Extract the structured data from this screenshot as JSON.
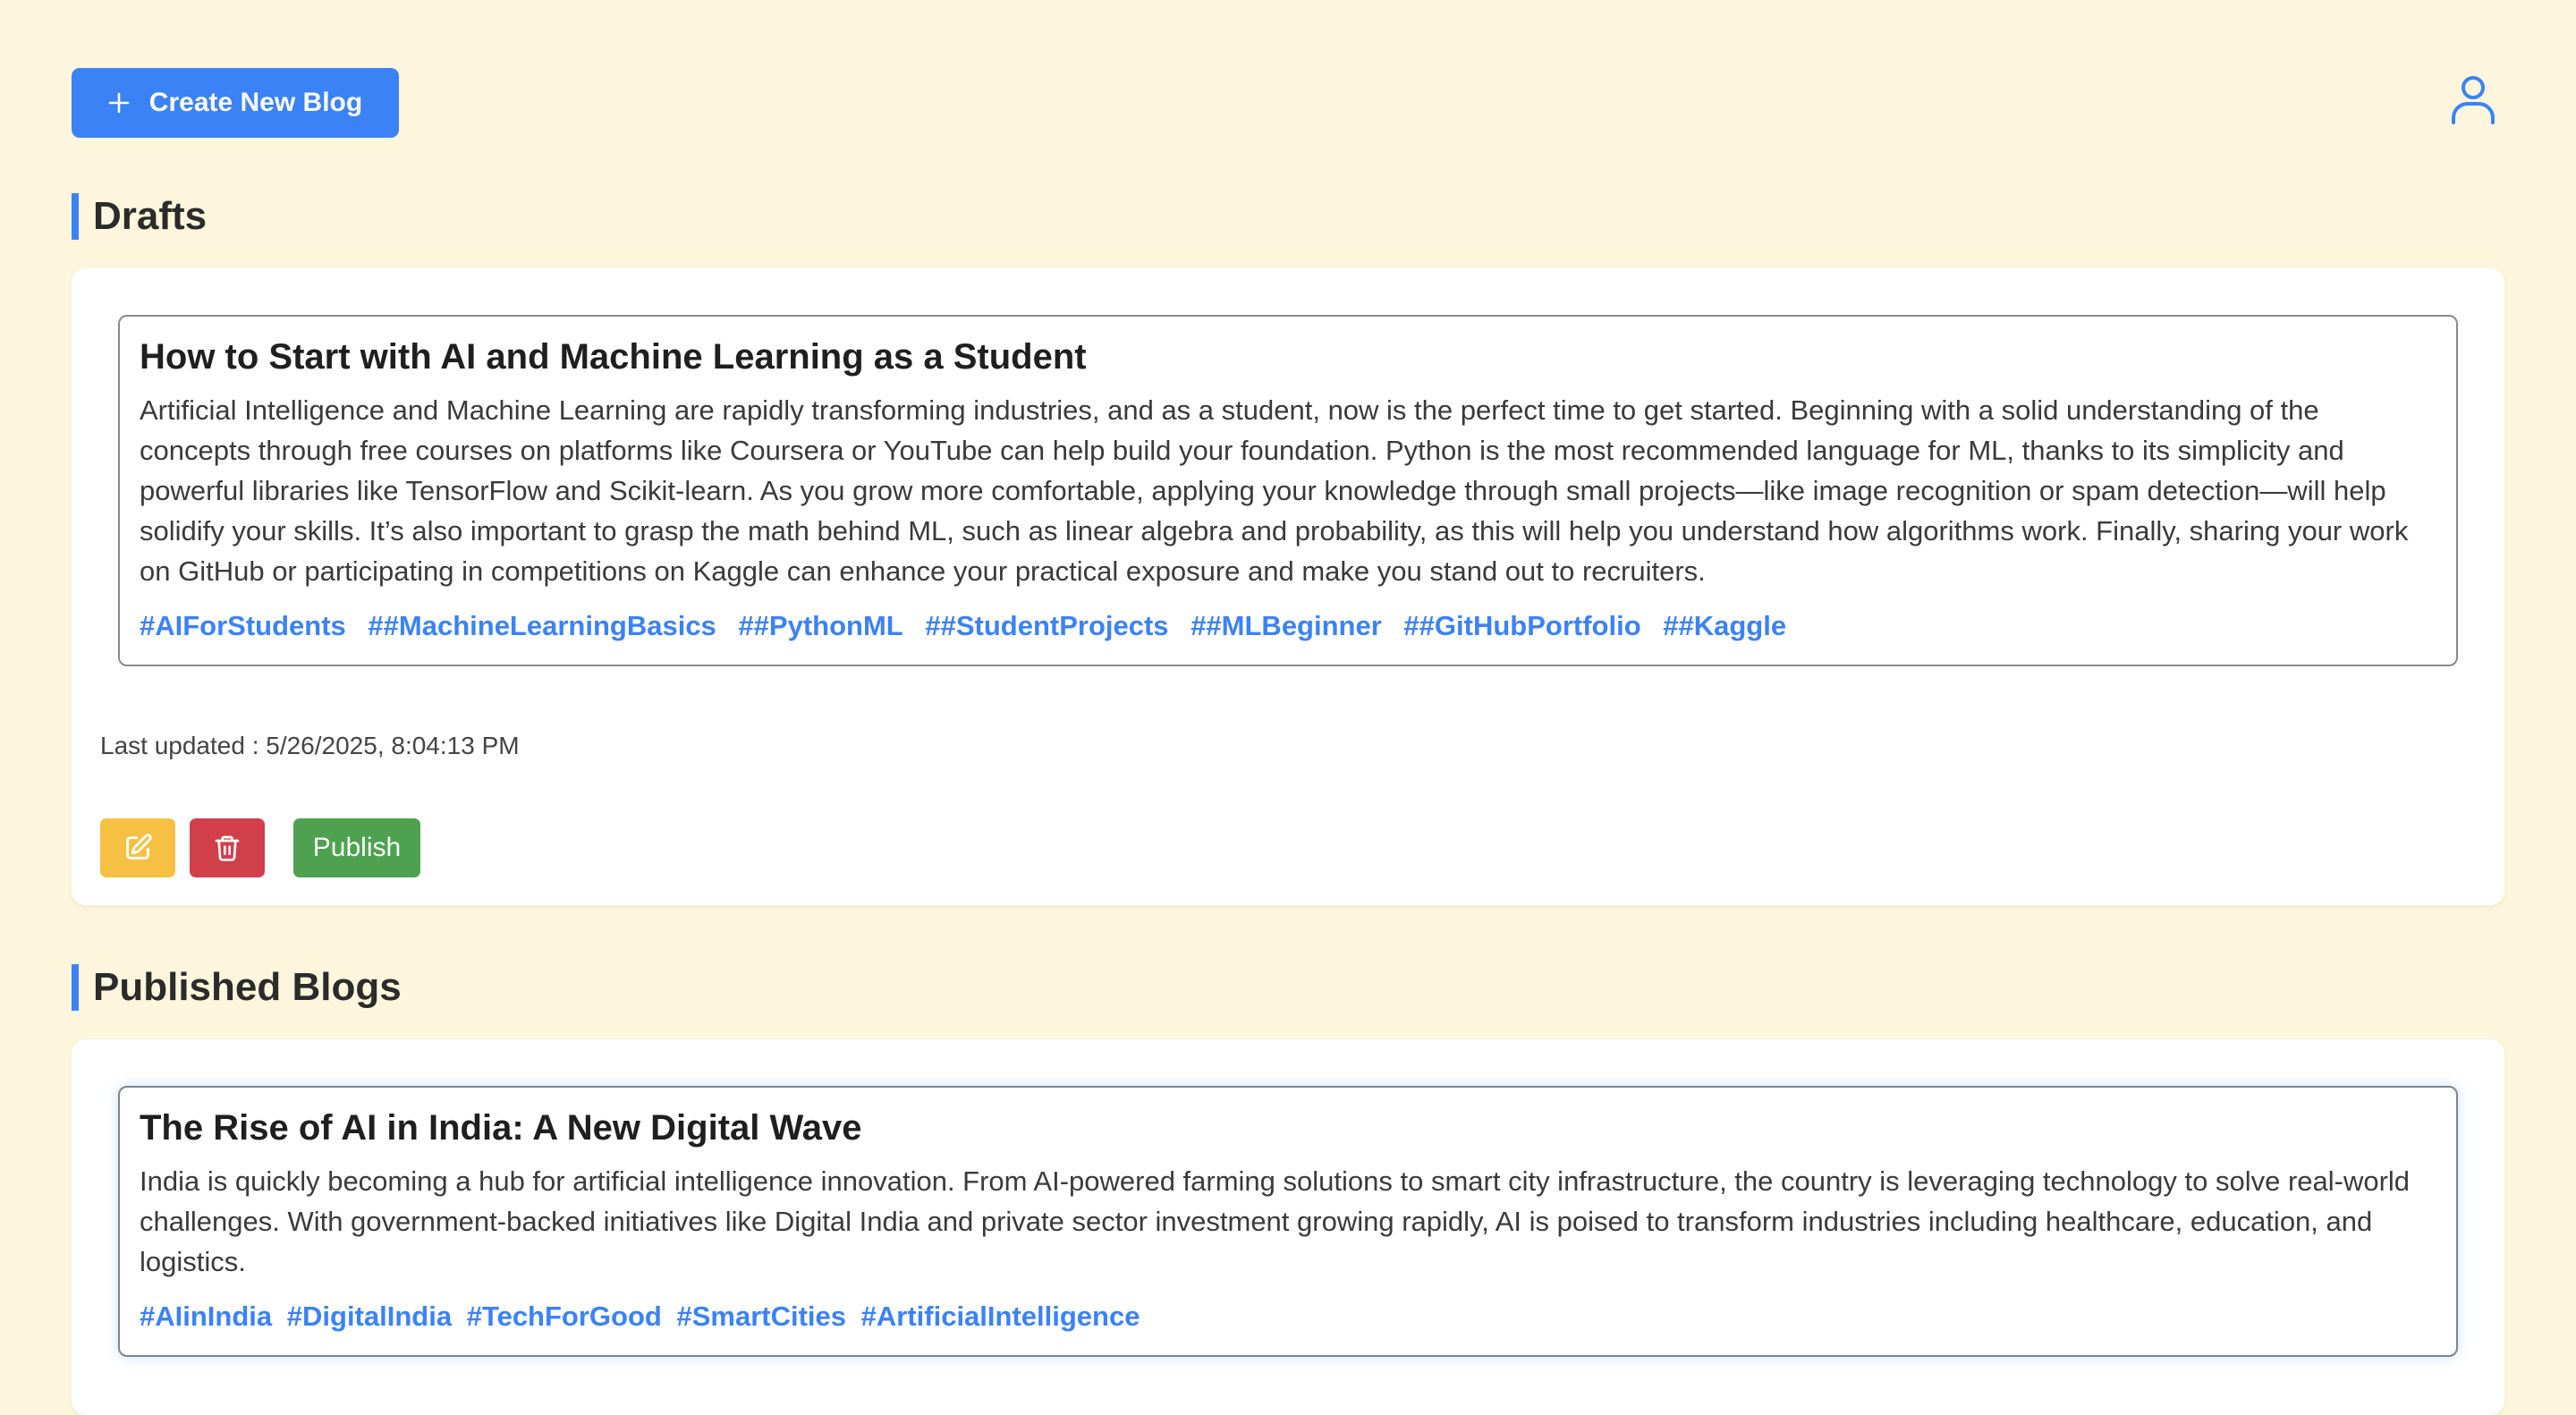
{
  "header": {
    "create_label": "Create New Blog"
  },
  "drafts": {
    "section_title": "Drafts",
    "items": [
      {
        "title": "How to Start with AI and Machine Learning as a Student",
        "body": "Artificial Intelligence and Machine Learning are rapidly transforming industries, and as a student, now is the perfect time to get started. Beginning with a solid understanding of the concepts through free courses on platforms like Coursera or YouTube can help build your foundation. Python is the most recommended language for ML, thanks to its simplicity and powerful libraries like TensorFlow and Scikit-learn. As you grow more comfortable, applying your knowledge through small projects—like image recognition or spam detection—will help solidify your skills. It’s also important to grasp the math behind ML, such as linear algebra and probability, as this will help you understand how algorithms work. Finally, sharing your work on GitHub or participating in competitions on Kaggle can enhance your practical exposure and make you stand out to recruiters.",
        "tags": [
          "#AIForStudents",
          "##MachineLearningBasics",
          "##PythonML",
          "##StudentProjects",
          "##MLBeginner",
          "##GitHubPortfolio",
          "##Kaggle"
        ],
        "last_updated": "Last updated : 5/26/2025, 8:04:13 PM",
        "publish_label": "Publish"
      }
    ]
  },
  "published": {
    "section_title": "Published Blogs",
    "items": [
      {
        "title": "The Rise of AI in India: A New Digital Wave",
        "body": "India is quickly becoming a hub for artificial intelligence innovation. From AI-powered farming solutions to smart city infrastructure, the country is leveraging technology to solve real-world challenges. With government-backed initiatives like Digital India and private sector investment growing rapidly, AI is poised to transform industries including healthcare, education, and logistics.",
        "tags": [
          "#AIinIndia",
          "#DigitalIndia",
          "#TechForGood",
          "#SmartCities",
          "#ArtificialIntelligence"
        ]
      }
    ]
  },
  "icons": {
    "create": "plus-icon",
    "user": "user-icon",
    "edit": "edit-icon",
    "delete": "trash-icon"
  },
  "colors": {
    "background": "#fdf6dc",
    "accent": "#3b82f6",
    "edit": "#f6c143",
    "delete": "#d1404a",
    "publish": "#4ea24f"
  }
}
